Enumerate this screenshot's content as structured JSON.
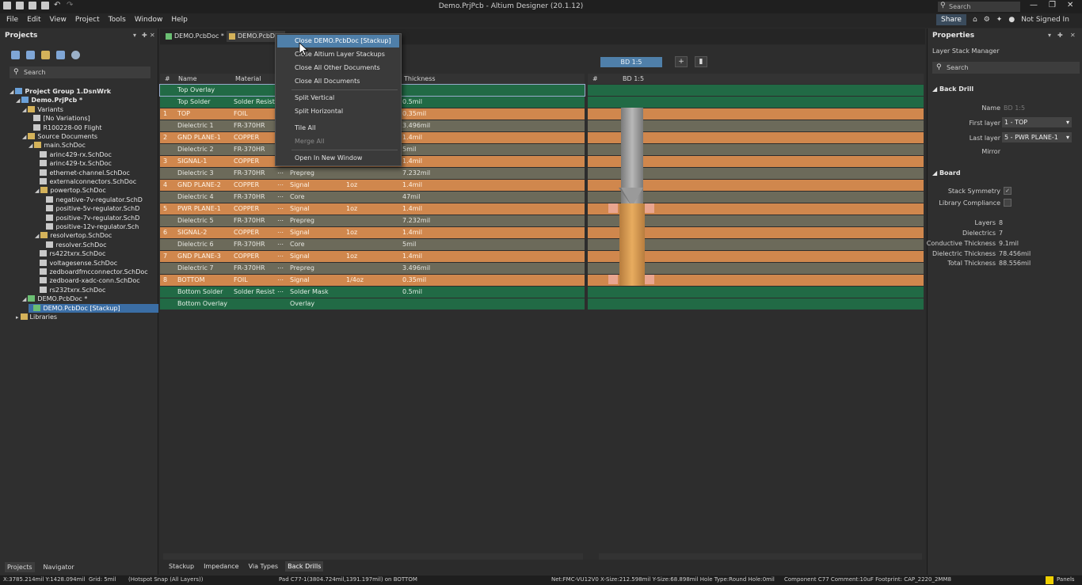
{
  "window": {
    "title": "Demo.PrjPcb - Altium Designer (20.1.12)",
    "search_placeholder": "Search"
  },
  "menubar": {
    "items": [
      "File",
      "Edit",
      "View",
      "Project",
      "Tools",
      "Window",
      "Help"
    ],
    "share": "Share",
    "user": "Not Signed In"
  },
  "projects_panel": {
    "title": "Projects",
    "search_placeholder": "Search",
    "tree": [
      {
        "label": "Project Group 1.DsnWrk",
        "level": 0,
        "type": "proj"
      },
      {
        "label": "Demo.PrjPcb *",
        "level": 1,
        "type": "proj"
      },
      {
        "label": "Variants",
        "level": 2,
        "type": "fold"
      },
      {
        "label": "[No Variations]",
        "level": 3,
        "type": "doc"
      },
      {
        "label": "R100228-00 Flight",
        "level": 3,
        "type": "doc"
      },
      {
        "label": "Source Documents",
        "level": 2,
        "type": "fold"
      },
      {
        "label": "main.SchDoc",
        "level": 3,
        "type": "fold"
      },
      {
        "label": "arinc429-rx.SchDoc",
        "level": 4,
        "type": "doc"
      },
      {
        "label": "arinc429-tx.SchDoc",
        "level": 4,
        "type": "doc"
      },
      {
        "label": "ethernet-channel.SchDoc",
        "level": 4,
        "type": "doc"
      },
      {
        "label": "externalconnectors.SchDoc",
        "level": 4,
        "type": "doc"
      },
      {
        "label": "powertop.SchDoc",
        "level": 4,
        "type": "fold"
      },
      {
        "label": "negative-7v-regulator.SchD",
        "level": 5,
        "type": "doc"
      },
      {
        "label": "positive-5v-regulator.SchD",
        "level": 5,
        "type": "doc"
      },
      {
        "label": "positive-7v-regulator.SchD",
        "level": 5,
        "type": "doc"
      },
      {
        "label": "positive-12v-regulator.Sch",
        "level": 5,
        "type": "doc"
      },
      {
        "label": "resolvertop.SchDoc",
        "level": 4,
        "type": "fold"
      },
      {
        "label": "resolver.SchDoc",
        "level": 5,
        "type": "doc"
      },
      {
        "label": "rs422txrx.SchDoc",
        "level": 4,
        "type": "doc"
      },
      {
        "label": "voltagesense.SchDoc",
        "level": 4,
        "type": "doc"
      },
      {
        "label": "zedboardfmcconnector.SchDoc",
        "level": 4,
        "type": "doc"
      },
      {
        "label": "zedboard-xadc-conn.SchDoc",
        "level": 4,
        "type": "doc"
      },
      {
        "label": "rs232txrx.SchDoc",
        "level": 4,
        "type": "doc"
      },
      {
        "label": "DEMO.PcbDoc *",
        "level": 2,
        "type": "pcb"
      },
      {
        "label": "DEMO.PcbDoc [Stackup]",
        "level": 3,
        "type": "pcb"
      },
      {
        "label": "Libraries",
        "level": 1,
        "type": "fold"
      }
    ],
    "bottom_tabs": [
      "Projects",
      "Navigator"
    ]
  },
  "doc_tabs": [
    "DEMO.PcbDoc *",
    "DEMO.PcbDoc"
  ],
  "context_menu": {
    "items": [
      "Close DEMO.PcbDoc [Stackup]",
      "Close Altium Layer Stackups",
      "Close All Other Documents",
      "Close All Documents",
      "Split Vertical",
      "Split Horizontal",
      "Tile All",
      "Merge All",
      "Open In New Window"
    ]
  },
  "stackup": {
    "bd_button": "BD 1:5",
    "headers": {
      "num": "#",
      "name": "Name",
      "material": "Material",
      "thickness": "Thickness"
    },
    "right_headers": {
      "num": "#",
      "bd": "BD 1:5"
    },
    "rows": [
      {
        "num": "",
        "name": "Top Overlay",
        "material": "",
        "type": "",
        "weight": "",
        "thickness": "",
        "c": "g"
      },
      {
        "num": "",
        "name": "Top Solder",
        "material": "Solder Resist",
        "type": "",
        "weight": "",
        "thickness": "0.5mil",
        "c": "g"
      },
      {
        "num": "1",
        "name": "TOP",
        "material": "FOIL",
        "type": "",
        "weight": "",
        "thickness": "0.35mil",
        "c": "o"
      },
      {
        "num": "",
        "name": "Dielectric 1",
        "material": "FR-370HR",
        "type": "",
        "weight": "",
        "thickness": "3.496mil",
        "c": "d"
      },
      {
        "num": "2",
        "name": "GND PLANE-1",
        "material": "COPPER",
        "type": "",
        "weight": "",
        "thickness": "1.4mil",
        "c": "o"
      },
      {
        "num": "",
        "name": "Dielectric 2",
        "material": "FR-370HR",
        "type": "",
        "weight": "",
        "thickness": "5mil",
        "c": "d"
      },
      {
        "num": "3",
        "name": "SIGNAL-1",
        "material": "COPPER",
        "type": "",
        "weight": "",
        "thickness": "1.4mil",
        "c": "o"
      },
      {
        "num": "",
        "name": "Dielectric 3",
        "material": "FR-370HR",
        "type": "Prepreg",
        "weight": "",
        "thickness": "7.232mil",
        "c": "d"
      },
      {
        "num": "4",
        "name": "GND PLANE-2",
        "material": "COPPER",
        "type": "Signal",
        "weight": "1oz",
        "thickness": "1.4mil",
        "c": "o"
      },
      {
        "num": "",
        "name": "Dielectric 4",
        "material": "FR-370HR",
        "type": "Core",
        "weight": "",
        "thickness": "47mil",
        "c": "d"
      },
      {
        "num": "5",
        "name": "PWR PLANE-1",
        "material": "COPPER",
        "type": "Signal",
        "weight": "1oz",
        "thickness": "1.4mil",
        "c": "o"
      },
      {
        "num": "",
        "name": "Dielectric 5",
        "material": "FR-370HR",
        "type": "Prepreg",
        "weight": "",
        "thickness": "7.232mil",
        "c": "d"
      },
      {
        "num": "6",
        "name": "SIGNAL-2",
        "material": "COPPER",
        "type": "Signal",
        "weight": "1oz",
        "thickness": "1.4mil",
        "c": "o"
      },
      {
        "num": "",
        "name": "Dielectric 6",
        "material": "FR-370HR",
        "type": "Core",
        "weight": "",
        "thickness": "5mil",
        "c": "d"
      },
      {
        "num": "7",
        "name": "GND PLANE-3",
        "material": "COPPER",
        "type": "Signal",
        "weight": "1oz",
        "thickness": "1.4mil",
        "c": "o"
      },
      {
        "num": "",
        "name": "Dielectric 7",
        "material": "FR-370HR",
        "type": "Prepreg",
        "weight": "",
        "thickness": "3.496mil",
        "c": "d"
      },
      {
        "num": "8",
        "name": "BOTTOM",
        "material": "FOIL",
        "type": "Signal",
        "weight": "1/4oz",
        "thickness": "0.35mil",
        "c": "o"
      },
      {
        "num": "",
        "name": "Bottom Solder",
        "material": "Solder Resist",
        "type": "Solder Mask",
        "weight": "",
        "thickness": "0.5mil",
        "c": "g"
      },
      {
        "num": "",
        "name": "Bottom Overlay",
        "material": "",
        "type": "Overlay",
        "weight": "",
        "thickness": "",
        "c": "g"
      }
    ],
    "bottom_tabs": [
      "Stackup",
      "Impedance",
      "Via Types",
      "Back Drills"
    ]
  },
  "properties": {
    "title": "Properties",
    "subtitle": "Layer Stack Manager",
    "search_placeholder": "Search",
    "back_drill": {
      "section": "Back Drill",
      "name_label": "Name",
      "name_value": "BD 1:5",
      "first_label": "First layer",
      "first_value": "1 - TOP",
      "last_label": "Last layer",
      "last_value": "5 - PWR PLANE-1",
      "mirror_label": "Mirror"
    },
    "board": {
      "section": "Board",
      "stack_sym": "Stack Symmetry",
      "lib_comp": "Library Compliance",
      "stats": [
        {
          "label": "Layers",
          "value": "8"
        },
        {
          "label": "Dielectrics",
          "value": "7"
        },
        {
          "label": "Conductive Thickness",
          "value": "9.1mil"
        },
        {
          "label": "Dielectric Thickness",
          "value": "78.456mil"
        },
        {
          "label": "Total Thickness",
          "value": "88.556mil"
        }
      ]
    }
  },
  "statusbar": {
    "coords": "X:3785.214mil Y:1428.094mil",
    "grid": "Grid: 5mil",
    "snap": "(Hotspot Snap (All Layers))",
    "pad": "Pad C77-1(3804.724mil,1391.197mil) on BOTTOM",
    "net": "Net:FMC-VU12V0 X-Size:212.598mil Y-Size:68.898mil Hole Type:Round Hole:0mil",
    "component": "Component C77 Comment:10uF Footprint: CAP_2220_2MM8",
    "panels": "Panels"
  },
  "colors": {
    "copper": "#d0874d",
    "dielectric": "#6c6a5a",
    "solder": "#216a45",
    "accent": "#4f7fa9"
  }
}
